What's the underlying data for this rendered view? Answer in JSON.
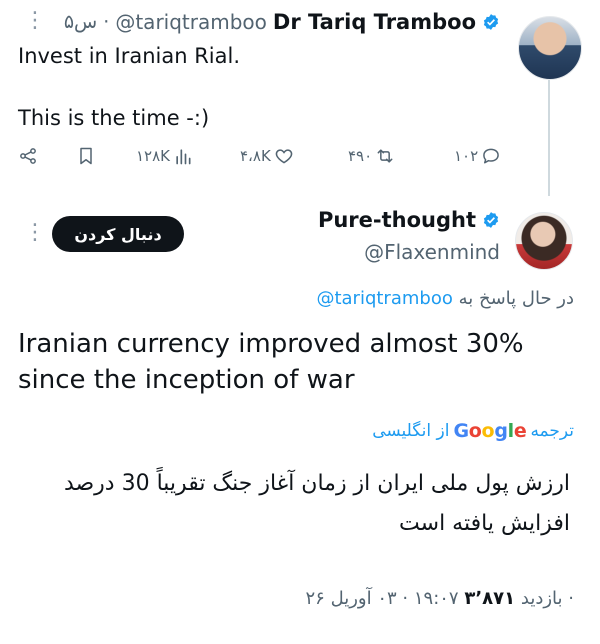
{
  "tweet1": {
    "menu_dots": "⋮",
    "timestamp": "۵س ·",
    "handle": "@tariqtramboo",
    "name": "Dr Tariq Tramboo",
    "line1": "Invest in Iranian Rial.",
    "line2": "This is the time -:)",
    "actions": {
      "views": "۱۲۸K",
      "likes": "۴،۸K",
      "retweets": "۴۹۰",
      "replies": "۱۰۲"
    }
  },
  "tweet2": {
    "menu_dots": "⋮",
    "follow_label": "دنبال کردن",
    "name": "Pure-thought",
    "handle": "@Flaxenmind",
    "reply_prefix": "در حال پاسخ به",
    "reply_mention": "@tariqtramboo",
    "text": "Iranian currency improved almost 30% since the inception of war",
    "translate_label": "ترجمه",
    "translate_brand": "Google",
    "translate_suffix": "از انگلیسی",
    "translated_text": "ارزش پول ملی ایران از زمان آغاز جنگ تقریباً 30 درصد افزایش یافته است",
    "meta_time": "۱۹:۰۷ · ۰۳ آوریل ۲۶ ·",
    "meta_views": "۳٬۸۷۱",
    "meta_views_label": "بازدید"
  },
  "colors": {
    "accent": "#1d9bf0",
    "text": "#0f1419",
    "muted": "#536471",
    "button": "#0f1419"
  }
}
